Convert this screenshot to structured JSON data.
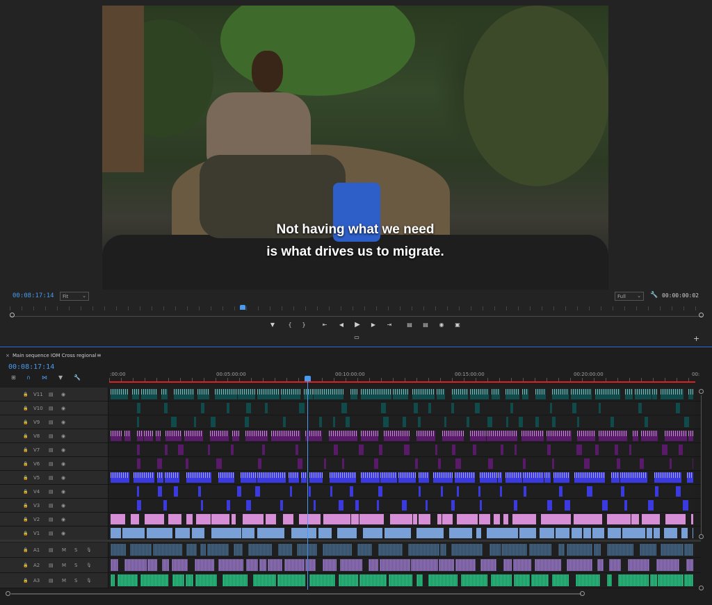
{
  "monitor": {
    "subtitle_line1": "Not having what we need",
    "subtitle_line2": "is what drives us to migrate.",
    "timecode": "00:08:17:14",
    "zoom": "Fit",
    "resolution": "Full",
    "duration": "00:00:00:02"
  },
  "timeline": {
    "tab_title": "Main sequence IOM Cross regional",
    "timecode": "00:08:17:14",
    "ruler": [
      ":00:00",
      "00:05:00:00",
      "00:10:00:00",
      "00:15:00:00",
      "00:20:00:00",
      "00:"
    ],
    "colors": {
      "teal": "#0f4b4b",
      "purple": "#5a1a6a",
      "blue": "#3a3ae0",
      "pink": "#d68fd6",
      "lightblue": "#7aa0d8",
      "audio_blue": "#4a6a8a",
      "audio_purple": "#9a7ac8",
      "green": "#2ec889"
    },
    "tracks": [
      {
        "id": "V11",
        "type": "video",
        "color": "teal"
      },
      {
        "id": "V10",
        "type": "video",
        "color": "teal"
      },
      {
        "id": "V9",
        "type": "video",
        "color": "teal"
      },
      {
        "id": "V8",
        "type": "video",
        "color": "purple"
      },
      {
        "id": "V7",
        "type": "video",
        "color": "purple"
      },
      {
        "id": "V6",
        "type": "video",
        "color": "purple"
      },
      {
        "id": "V5",
        "type": "video",
        "color": "blue"
      },
      {
        "id": "V4",
        "type": "video",
        "color": "blue"
      },
      {
        "id": "V3",
        "type": "video",
        "color": "blue"
      },
      {
        "id": "V2",
        "type": "video",
        "color": "pink"
      },
      {
        "id": "V1",
        "type": "video",
        "color": "lightblue"
      },
      {
        "id": "A1",
        "type": "audio",
        "color": "audio_blue"
      },
      {
        "id": "A2",
        "type": "audio",
        "color": "audio_purple"
      },
      {
        "id": "A3",
        "type": "audio",
        "color": "green"
      }
    ],
    "audio_buttons": {
      "mute": "M",
      "solo": "S"
    }
  }
}
